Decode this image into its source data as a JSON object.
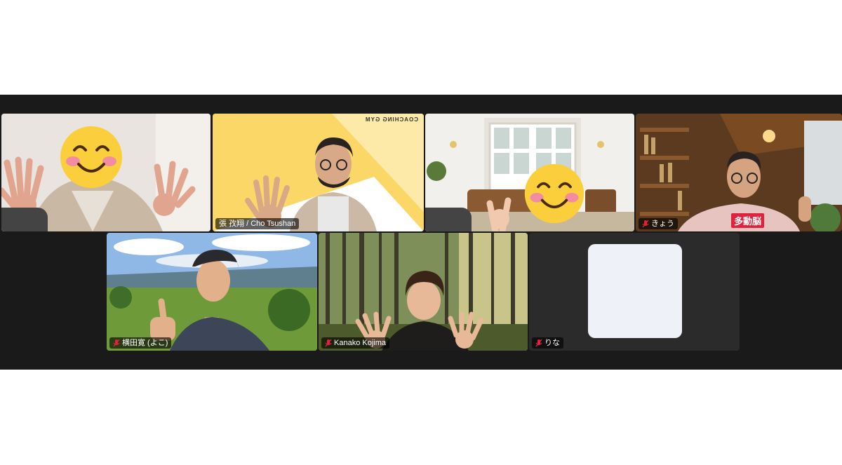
{
  "participants": [
    {
      "name": "",
      "muted": false
    },
    {
      "name": "張 孜翔 / Cho Tsushan",
      "muted": false,
      "background_text": "COACHING GYM"
    },
    {
      "name": "",
      "muted": false
    },
    {
      "name": "きょう",
      "muted": true,
      "sign_text": "多動脳"
    },
    {
      "name": "横田寛 (よこ)",
      "muted": true
    },
    {
      "name": "Kanako Kojima",
      "muted": true
    },
    {
      "name": "りな",
      "muted": true
    }
  ],
  "colors": {
    "speaker_border": "#2fbf4a",
    "stage_bg": "#1a1a1a",
    "mute_icon": "#e0233c"
  },
  "icons": {
    "mute": "mic-muted-icon",
    "face_cover": "smiling-face-emoji"
  }
}
